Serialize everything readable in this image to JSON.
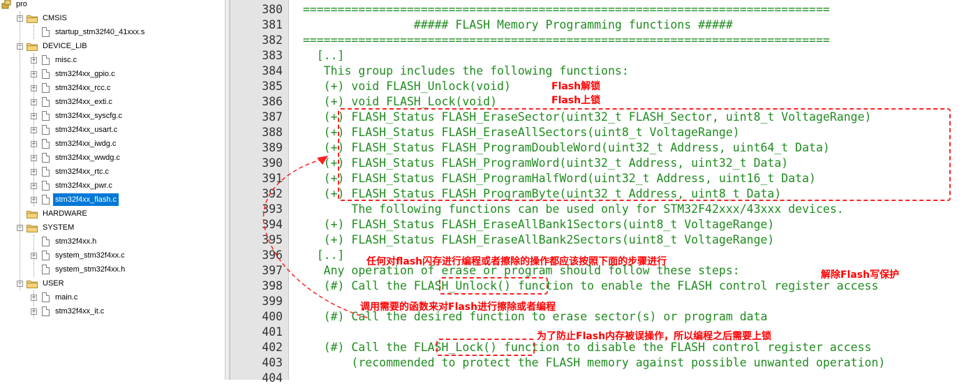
{
  "tree": {
    "items": [
      {
        "label": "pro",
        "type": "root",
        "depth": 0,
        "expander": ""
      },
      {
        "label": "CMSIS",
        "type": "folder",
        "depth": 1,
        "expander": "−"
      },
      {
        "label": "startup_stm32f40_41xxx.s",
        "type": "file",
        "depth": 2,
        "expander": ""
      },
      {
        "label": "DEVICE_LIB",
        "type": "folder",
        "depth": 1,
        "expander": "−"
      },
      {
        "label": "misc.c",
        "type": "file",
        "depth": 2,
        "expander": "+"
      },
      {
        "label": "stm32f4xx_gpio.c",
        "type": "file",
        "depth": 2,
        "expander": "+"
      },
      {
        "label": "stm32f4xx_rcc.c",
        "type": "file",
        "depth": 2,
        "expander": "+"
      },
      {
        "label": "stm32f4xx_exti.c",
        "type": "file",
        "depth": 2,
        "expander": "+"
      },
      {
        "label": "stm32f4xx_syscfg.c",
        "type": "file",
        "depth": 2,
        "expander": "+"
      },
      {
        "label": "stm32f4xx_usart.c",
        "type": "file",
        "depth": 2,
        "expander": "+"
      },
      {
        "label": "stm32f4xx_iwdg.c",
        "type": "file",
        "depth": 2,
        "expander": "+"
      },
      {
        "label": "stm32f4xx_wwdg.c",
        "type": "file",
        "depth": 2,
        "expander": "+"
      },
      {
        "label": "stm32f4xx_rtc.c",
        "type": "file",
        "depth": 2,
        "expander": "+"
      },
      {
        "label": "stm32f4xx_pwr.c",
        "type": "file",
        "depth": 2,
        "expander": "+"
      },
      {
        "label": "stm32f4xx_flash.c",
        "type": "file",
        "depth": 2,
        "expander": "+",
        "selected": true
      },
      {
        "label": "HARDWARE",
        "type": "folder",
        "depth": 1,
        "expander": ""
      },
      {
        "label": "SYSTEM",
        "type": "folder",
        "depth": 1,
        "expander": "−"
      },
      {
        "label": "stm32f4xx.h",
        "type": "file",
        "depth": 2,
        "expander": ""
      },
      {
        "label": "system_stm32f4xx.c",
        "type": "file",
        "depth": 2,
        "expander": "+"
      },
      {
        "label": "system_stm32f4xx.h",
        "type": "file",
        "depth": 2,
        "expander": ""
      },
      {
        "label": "USER",
        "type": "folder",
        "depth": 1,
        "expander": "−"
      },
      {
        "label": "main.c",
        "type": "file",
        "depth": 2,
        "expander": "+"
      },
      {
        "label": "stm32f4xx_it.c",
        "type": "file",
        "depth": 2,
        "expander": "+"
      }
    ]
  },
  "editor": {
    "code_color": "#1f8c1f",
    "lines": [
      {
        "num": "380",
        "text": "  ============================================================================"
      },
      {
        "num": "381",
        "text": "                  ##### FLASH Memory Programming functions #####"
      },
      {
        "num": "382",
        "text": "  ============================================================================"
      },
      {
        "num": "383",
        "text": "    [..]"
      },
      {
        "num": "384",
        "text": "     This group includes the following functions:"
      },
      {
        "num": "385",
        "text": "     (+) void FLASH_Unlock(void)"
      },
      {
        "num": "386",
        "text": "     (+) void FLASH_Lock(void)"
      },
      {
        "num": "387",
        "text": "     (+) FLASH_Status FLASH_EraseSector(uint32_t FLASH_Sector, uint8_t VoltageRange)"
      },
      {
        "num": "388",
        "text": "     (+) FLASH_Status FLASH_EraseAllSectors(uint8_t VoltageRange)"
      },
      {
        "num": "389",
        "text": "     (+) FLASH_Status FLASH_ProgramDoubleWord(uint32_t Address, uint64_t Data)"
      },
      {
        "num": "390",
        "text": "     (+) FLASH_Status FLASH_ProgramWord(uint32_t Address, uint32_t Data)"
      },
      {
        "num": "391",
        "text": "     (+) FLASH_Status FLASH_ProgramHalfWord(uint32_t Address, uint16_t Data)"
      },
      {
        "num": "392",
        "text": "     (+) FLASH_Status FLASH_ProgramByte(uint32_t Address, uint8_t Data)"
      },
      {
        "num": "393",
        "text": "         The following functions can be used only for STM32F42xxx/43xxx devices."
      },
      {
        "num": "394",
        "text": "     (+) FLASH_Status FLASH_EraseAllBank1Sectors(uint8_t VoltageRange)"
      },
      {
        "num": "395",
        "text": "     (+) FLASH_Status FLASH_EraseAllBank2Sectors(uint8_t VoltageRange)"
      },
      {
        "num": "396",
        "text": "    [..]"
      },
      {
        "num": "397",
        "text": "     Any operation of erase or program should follow these steps:"
      },
      {
        "num": "398",
        "text": "     (#) Call the FLASH_Unlock() function to enable the FLASH control register access"
      },
      {
        "num": "399",
        "text": ""
      },
      {
        "num": "400",
        "text": "     (#) Call the desired function to erase sector(s) or program data"
      },
      {
        "num": "401",
        "text": ""
      },
      {
        "num": "402",
        "text": "     (#) Call the FLASH_Lock() function to disable the FLASH control register access"
      },
      {
        "num": "403",
        "text": "         (recommended to protect the FLASH memory against possible unwanted operation)"
      },
      {
        "num": "404",
        "text": ""
      }
    ]
  },
  "annotations": {
    "color": "#ff0000",
    "unlock_note": "Flash解锁",
    "lock_note": "Flash上锁",
    "steps_note": "任何对flash闪存进行编程或者擦除的操作都应该按照下面的步骤进行",
    "write_protect_note": "解除Flash写保护",
    "call_note": "调用需要的函数来对Flash进行擦除或者编程",
    "relock_note": "为了防止Flash内存被误操作，所以编程之后需要上锁"
  }
}
